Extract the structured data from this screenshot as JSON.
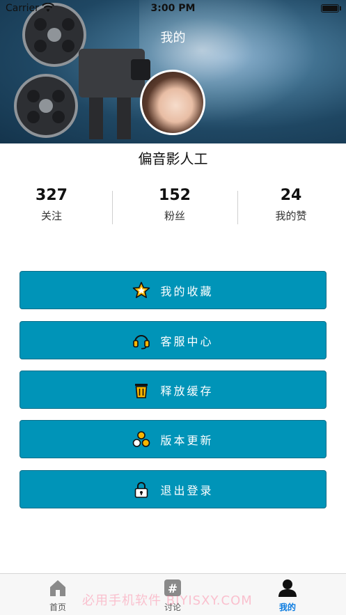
{
  "status_bar": {
    "carrier": "Carrier",
    "time": "3:00 PM"
  },
  "header": {
    "title": "我的"
  },
  "profile": {
    "username": "偏音影人工"
  },
  "stats": [
    {
      "value": "327",
      "label": "关注"
    },
    {
      "value": "152",
      "label": "粉丝"
    },
    {
      "value": "24",
      "label": "我的赞"
    }
  ],
  "menu": [
    {
      "label": "我的收藏",
      "icon": "star-icon"
    },
    {
      "label": "客服中心",
      "icon": "headset-icon"
    },
    {
      "label": "释放缓存",
      "icon": "trash-icon"
    },
    {
      "label": "版本更新",
      "icon": "update-icon"
    },
    {
      "label": "退出登录",
      "icon": "lock-icon"
    }
  ],
  "tabbar": [
    {
      "label": "首页",
      "icon": "home-icon",
      "active": false
    },
    {
      "label": "讨论",
      "icon": "hashtag-icon",
      "active": false
    },
    {
      "label": "我的",
      "icon": "user-icon",
      "active": true
    }
  ],
  "watermark": "必用手机软件 BIYISXY.COM",
  "colors": {
    "button_bg": "#0094b8",
    "active_tab": "#0a7be0"
  }
}
